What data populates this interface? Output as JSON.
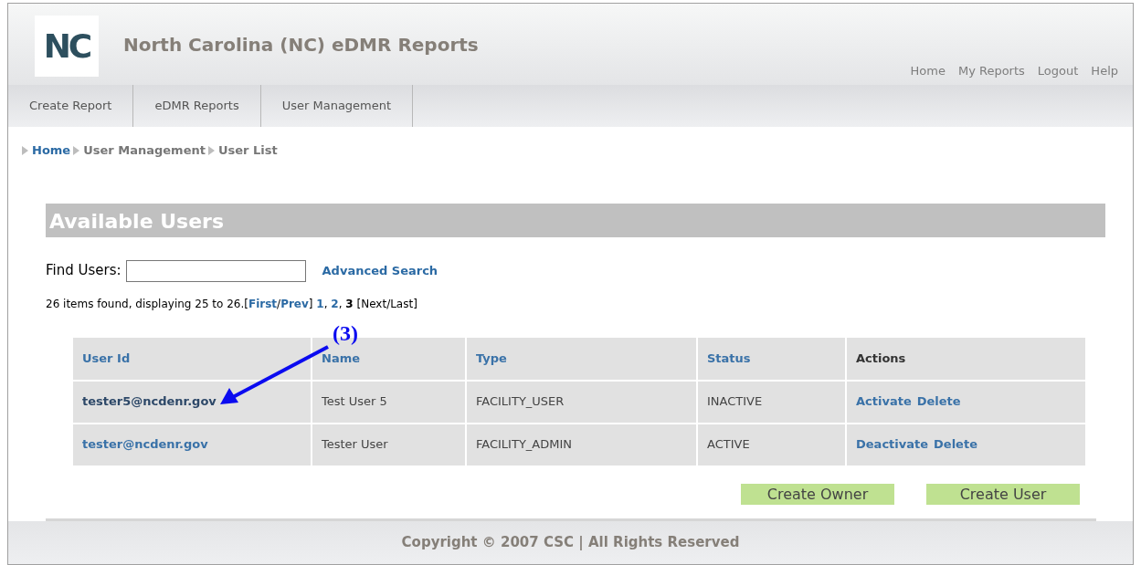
{
  "header": {
    "logo": "NC",
    "title": "North Carolina (NC) eDMR Reports",
    "links": [
      "Home",
      "My Reports",
      "Logout",
      "Help"
    ]
  },
  "tabs": [
    {
      "label": "Create Report",
      "selected": false
    },
    {
      "label": "eDMR Reports",
      "selected": false
    },
    {
      "label": "User Management",
      "selected": false
    }
  ],
  "breadcrumb": [
    {
      "label": "Home",
      "link": true
    },
    {
      "label": "User Management",
      "link": false
    },
    {
      "label": "User List",
      "link": false
    }
  ],
  "section_title": "Available Users",
  "search": {
    "label": "Find Users:",
    "advanced_link": "Advanced Search"
  },
  "pager": [
    {
      "kind": "text",
      "text": "26 items found, displaying 25 to 26.["
    },
    {
      "kind": "link",
      "text": "First"
    },
    {
      "kind": "text",
      "text": "/"
    },
    {
      "kind": "link",
      "text": "Prev"
    },
    {
      "kind": "text",
      "text": "] "
    },
    {
      "kind": "link",
      "text": "1"
    },
    {
      "kind": "text",
      "text": ", "
    },
    {
      "kind": "link",
      "text": "2"
    },
    {
      "kind": "text",
      "text": ", "
    },
    {
      "kind": "current",
      "text": "3"
    },
    {
      "kind": "text",
      "text": " [Next/Last]"
    }
  ],
  "table": {
    "columns": [
      {
        "label": "User Id",
        "sortable": true
      },
      {
        "label": "Name",
        "sortable": true
      },
      {
        "label": "Type",
        "sortable": true
      },
      {
        "label": "Status",
        "sortable": true
      },
      {
        "label": "Actions",
        "sortable": false
      }
    ],
    "rows": [
      {
        "user_id": "tester5@ncdenr.gov",
        "visited": true,
        "name": "Test User 5",
        "type": "FACILITY_USER",
        "status": "INACTIVE",
        "actions": [
          "Activate",
          "Delete"
        ]
      },
      {
        "user_id": "tester@ncdenr.gov",
        "visited": false,
        "name": "Tester User",
        "type": "FACILITY_ADMIN",
        "status": "ACTIVE",
        "actions": [
          "Deactivate",
          "Delete"
        ]
      }
    ]
  },
  "buttons": [
    "Create Owner",
    "Create User"
  ],
  "annotation": {
    "label": "(3)"
  },
  "footer": "Copyright © 2007 CSC | All Rights Reserved"
}
